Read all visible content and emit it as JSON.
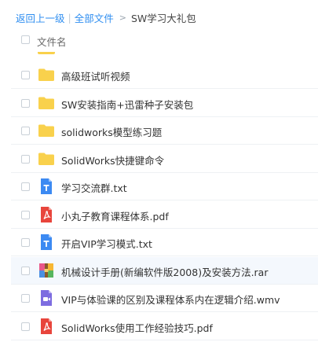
{
  "breadcrumb": {
    "back": "返回上一级",
    "separator": "|",
    "all_files": "全部文件",
    "arrow": ">",
    "current": "SW学习大礼包"
  },
  "header": {
    "column_label": "文件名"
  },
  "colors": {
    "link": "#2f8ef0",
    "folder": "#f9d14c",
    "pdf": "#e8453c",
    "txt": "#3c8af2",
    "video": "#7d6ce0",
    "row_highlight": "#f4f8fd"
  },
  "files": [
    {
      "name": "高级班试听视频",
      "icon": "folder-icon"
    },
    {
      "name": "SW安装指南+迅雷种子安装包",
      "icon": "folder-icon"
    },
    {
      "name": "solidworks模型练习题",
      "icon": "folder-icon"
    },
    {
      "name": "SolidWorks快捷键命令",
      "icon": "folder-icon"
    },
    {
      "name": "学习交流群.txt",
      "icon": "txt-file-icon"
    },
    {
      "name": "小丸子教育课程体系.pdf",
      "icon": "pdf-file-icon"
    },
    {
      "name": "开启VIP学习模式.txt",
      "icon": "txt-file-icon"
    },
    {
      "name": "机械设计手册(新编软件版2008)及安装方法.rar",
      "icon": "rar-archive-icon",
      "highlighted": true
    },
    {
      "name": "VIP与体验课的区别及课程体系内在逻辑介绍.wmv",
      "icon": "video-file-icon"
    },
    {
      "name": "SolidWorks使用工作经验技巧.pdf",
      "icon": "pdf-file-icon"
    }
  ]
}
